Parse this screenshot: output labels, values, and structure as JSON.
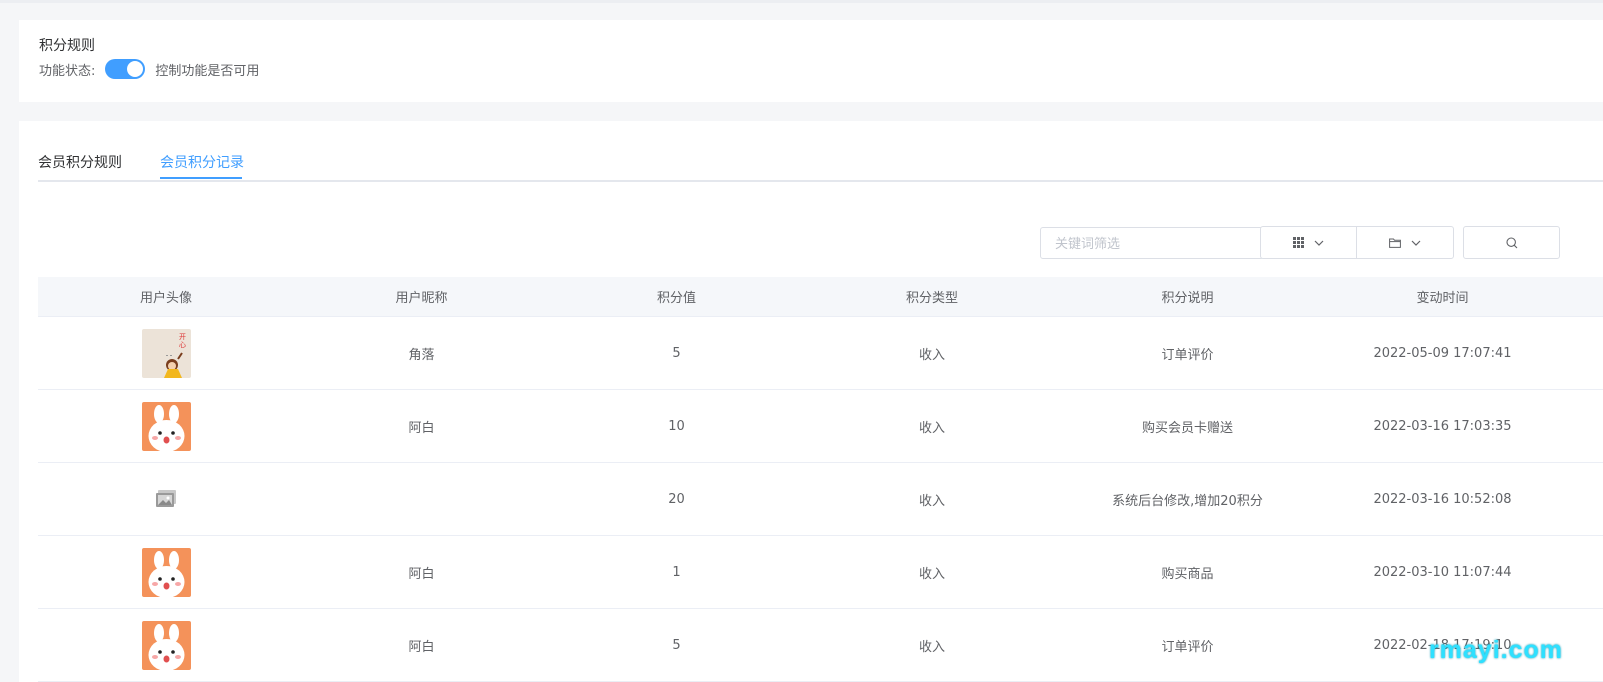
{
  "rule_card": {
    "title": "积分规则",
    "status_label": "功能状态:",
    "toggle_on": true,
    "status_desc": "控制功能是否可用"
  },
  "tabs": [
    {
      "label": "会员积分规则",
      "active": false
    },
    {
      "label": "会员积分记录",
      "active": true
    }
  ],
  "toolbar": {
    "search_placeholder": "关键词筛选",
    "columns_icon": "grid-icon",
    "export_icon": "folder-icon",
    "search_icon": "search-icon"
  },
  "table": {
    "headers": [
      "用户头像",
      "用户昵称",
      "积分值",
      "积分类型",
      "积分说明",
      "变动时间"
    ],
    "rows": [
      {
        "avatar": "happy-girl-avatar",
        "nickname": "角落",
        "points": "5",
        "type": "收入",
        "desc": "订单评价",
        "time": "2022-05-09 17:07:41"
      },
      {
        "avatar": "bunny-avatar",
        "nickname": "阿白",
        "points": "10",
        "type": "收入",
        "desc": "购买会员卡赠送",
        "time": "2022-03-16 17:03:35"
      },
      {
        "avatar": "image-placeholder-icon",
        "nickname": "",
        "points": "20",
        "type": "收入",
        "desc": "系统后台修改,增加20积分",
        "time": "2022-03-16 10:52:08"
      },
      {
        "avatar": "bunny-avatar",
        "nickname": "阿白",
        "points": "1",
        "type": "收入",
        "desc": "购买商品",
        "time": "2022-03-10 11:07:44"
      },
      {
        "avatar": "bunny-avatar",
        "nickname": "阿白",
        "points": "5",
        "type": "收入",
        "desc": "订单评价",
        "time": "2022-02-18 17:19:10"
      }
    ]
  },
  "watermark": "rmayi.com",
  "colors": {
    "accent": "#409eff",
    "header_bg": "#f5f7fa",
    "watermark": "#2ee0ff"
  }
}
